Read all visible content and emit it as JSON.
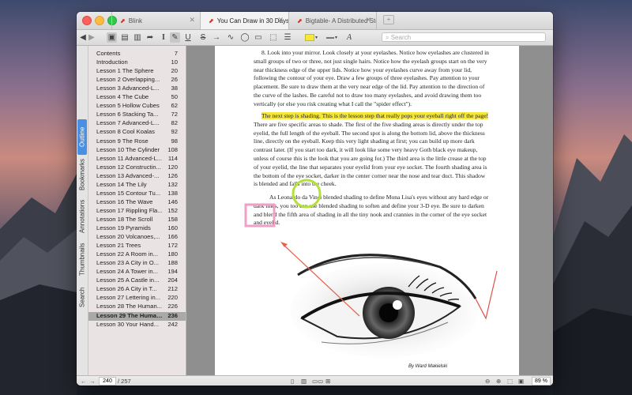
{
  "tabs": [
    {
      "label": "Blink",
      "active": false
    },
    {
      "label": "You Can Draw in 30 Days co",
      "active": true
    },
    {
      "label": "Bigtable- A Distributed Stor",
      "active": false
    }
  ],
  "toolbar": {
    "search_placeholder": "Search"
  },
  "sidebar": {
    "tabs": [
      "Outline",
      "Bookmarks",
      "Annotations",
      "Thumbnails",
      "Search"
    ],
    "active_tab": "Outline",
    "items": [
      {
        "label": "Contents",
        "page": "7"
      },
      {
        "label": "Introduction",
        "page": "10"
      },
      {
        "label": "Lesson 1 The Sphere",
        "page": "20"
      },
      {
        "label": "Lesson 2 Overlapping...",
        "page": "26"
      },
      {
        "label": "Lesson 3 Advanced-L...",
        "page": "38"
      },
      {
        "label": "Lesson 4 The Cube",
        "page": "50"
      },
      {
        "label": "Lesson 5 Hollow Cubes",
        "page": "62"
      },
      {
        "label": "Lesson 6 Stacking Ta...",
        "page": "72"
      },
      {
        "label": "Lesson 7 Advanced-L...",
        "page": "82"
      },
      {
        "label": "Lesson 8 Cool Koalas",
        "page": "92"
      },
      {
        "label": "Lesson 9 The Rose",
        "page": "98"
      },
      {
        "label": "Lesson 10 The Cylinder",
        "page": "108"
      },
      {
        "label": "Lesson 11 Advanced-L...",
        "page": "114"
      },
      {
        "label": "Lesson 12 Constructin...",
        "page": "120"
      },
      {
        "label": "Lesson 13 Advanced-...",
        "page": "126"
      },
      {
        "label": "Lesson 14 The Lily",
        "page": "132"
      },
      {
        "label": "Lesson 15 Contour Tu...",
        "page": "138"
      },
      {
        "label": "Lesson 16 The Wave",
        "page": "146"
      },
      {
        "label": "Lesson 17 Rippling Fla...",
        "page": "152"
      },
      {
        "label": "Lesson 18 The Scroll",
        "page": "158"
      },
      {
        "label": "Lesson 19 Pyramids",
        "page": "160"
      },
      {
        "label": "Lesson 20 Volcanoes,...",
        "page": "166"
      },
      {
        "label": "Lesson 21 Trees",
        "page": "172"
      },
      {
        "label": "Lesson 22 A Room in...",
        "page": "180"
      },
      {
        "label": "Lesson 23 A City in O...",
        "page": "188"
      },
      {
        "label": "Lesson 24 A Tower in...",
        "page": "194"
      },
      {
        "label": "Lesson 25 A Castle in...",
        "page": "204"
      },
      {
        "label": "Lesson 26 A City in T...",
        "page": "212"
      },
      {
        "label": "Lesson 27 Lettering in...",
        "page": "220"
      },
      {
        "label": "Lesson 28 The Human...",
        "page": "226"
      },
      {
        "label": "Lesson 29 The Human...",
        "page": "236"
      },
      {
        "label": "Lesson 30 Your Hand...",
        "page": "242"
      }
    ],
    "selected_index": 30
  },
  "document": {
    "para1": "8. Look into your mirror. Look closely at your eyelashes. Notice how eyelashes are clustered in small groups of two or three, not just single hairs. Notice how the eyelash groups start on the very near thickness edge of the upper lids. Notice how your eyelashes curve away from your lid, following the contour of your eye. Draw a few groups of three eyelashes. Pay attention to your placement. Be sure to draw them at the very near edge of the lid. Pay attention to the direction of the curve of the lashes. Be careful not to draw too many eyelashes, and avoid drawing them too vertically (or else you risk creating what I call the \"spider effect\").",
    "para2_highlight": "The next step is shading. This is the lesson step that really pops your eyeball right off the page!",
    "para2_rest": " There are five specific areas to shade. The first of the five shading areas is directly under the top eyelid, the full length of the eyeball. The second spot is along the bottom lid, above the thickness line, directly on the eyeball. Keep this very light shading at first; you can build up more dark contrast later. (If you start too dark, it will look like some very heavy Goth black eye makeup, unless of course this is the look that you are going for.) The third area is the little crease at the top of your eyelid, the line that separates your eyelid from your eye socket. The fourth shading area is the bottom of the eye socket, darker in the center corner near the nose and tear duct. This shadow is blended and falls into the cheek.",
    "para3": "As Leonardo da Vinci blended shading to define Mona Lisa's eyes without any hard edge or dark lines, you too can use blended shading to soften and define your 3-D eye. Be sure to darken and blend the fifth area of shading in all the tiny nook and crannies in the corner of the eye socket and eyelid.",
    "caption": "By Ward Makielski"
  },
  "status": {
    "current_page": "240",
    "total_pages": "/ 257",
    "zoom": "89",
    "zoom_unit": "%"
  },
  "colors": {
    "highlight": "#f5e83a",
    "annotation_circle": "#b5e03c",
    "annotation_box": "#f0a0c8",
    "annotation_arrow": "#e8604c",
    "check_mark": "#e0504a"
  }
}
